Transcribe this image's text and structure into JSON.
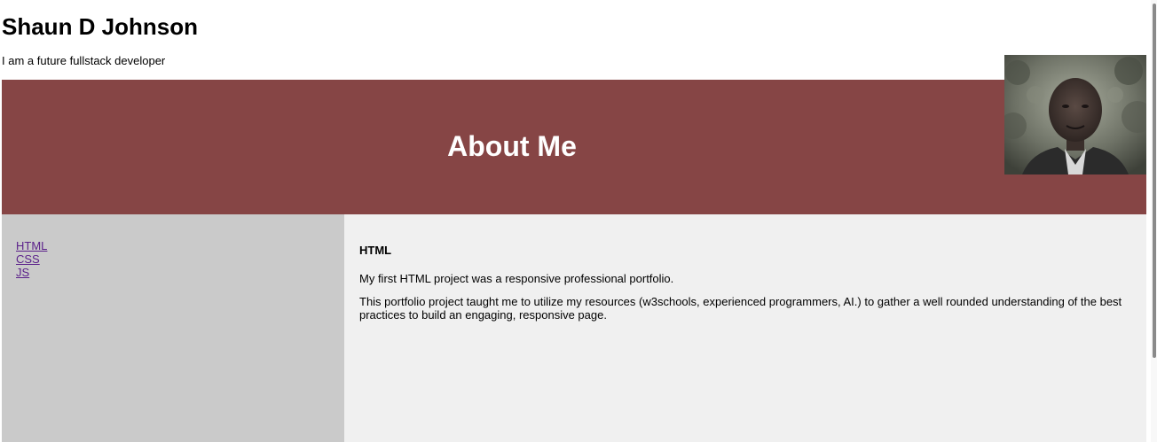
{
  "header": {
    "name": "Shaun D Johnson",
    "tagline": "I am a future fullstack developer"
  },
  "banner": {
    "title": "About Me",
    "color": "#864545"
  },
  "portrait": {
    "icon": "profile-photo"
  },
  "sidebar": {
    "links": [
      {
        "label": "HTML"
      },
      {
        "label": "CSS"
      },
      {
        "label": "JS"
      }
    ]
  },
  "content": {
    "heading": "HTML",
    "paragraphs": [
      "My first HTML project was a responsive professional portfolio.",
      "This portfolio project taught me to utilize my resources (w3schools, experienced programmers, AI.) to gather a well rounded understanding of the best practices to build an engaging, responsive page."
    ]
  }
}
